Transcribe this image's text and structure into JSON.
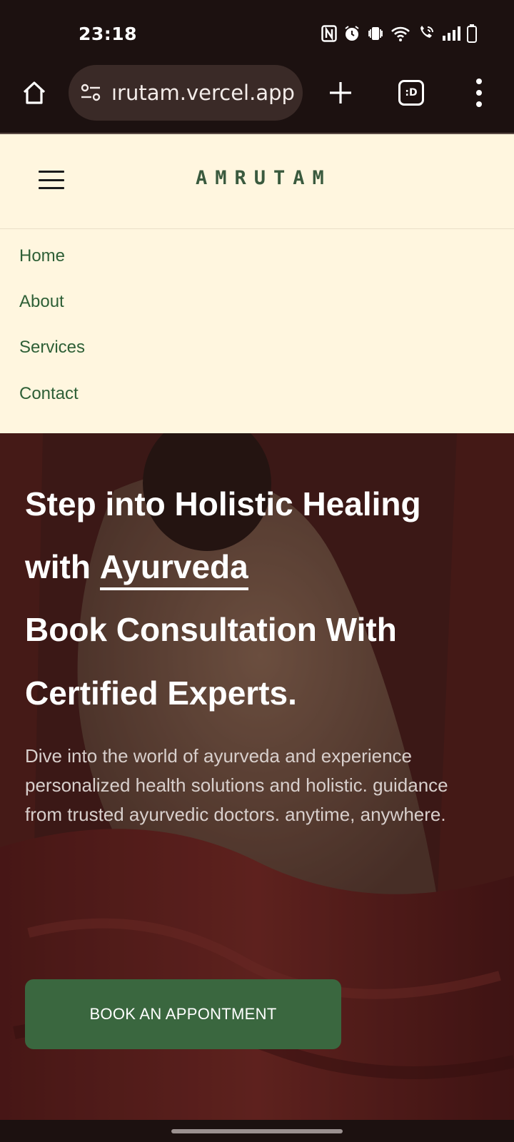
{
  "status_bar": {
    "time": "23:18",
    "icons": [
      "nfc-icon",
      "alarm-icon",
      "vibrate-icon",
      "wifi-icon",
      "wifi-calling-icon",
      "signal-icon",
      "battery-icon"
    ]
  },
  "browser": {
    "url": "ırutam.vercel.app",
    "tabs_label": ":D"
  },
  "site": {
    "logo": "AMRUTAM",
    "nav": {
      "items": [
        {
          "label": "Home"
        },
        {
          "label": "About"
        },
        {
          "label": "Services"
        },
        {
          "label": "Contact"
        }
      ]
    },
    "hero": {
      "title_line1": "Step into Holistic Healing",
      "title_line2_prefix": "with",
      "title_line2_highlight": "Ayurveda",
      "title_line3": "Book Consultation With",
      "title_line4": "Certified Experts.",
      "description": "Dive into the world of ayurveda and experience personalized health solutions and holistic. guidance from trusted ayurvedic doctors. anytime, anywhere.",
      "cta_label": "BOOK AN APPONTMENT"
    }
  },
  "colors": {
    "browser_bg": "#1c1110",
    "header_bg": "#fff6df",
    "nav_text": "#2e5f36",
    "logo": "#3a5a3e",
    "cta_bg": "#3a673f",
    "hero_bg": "#4a2a26"
  }
}
